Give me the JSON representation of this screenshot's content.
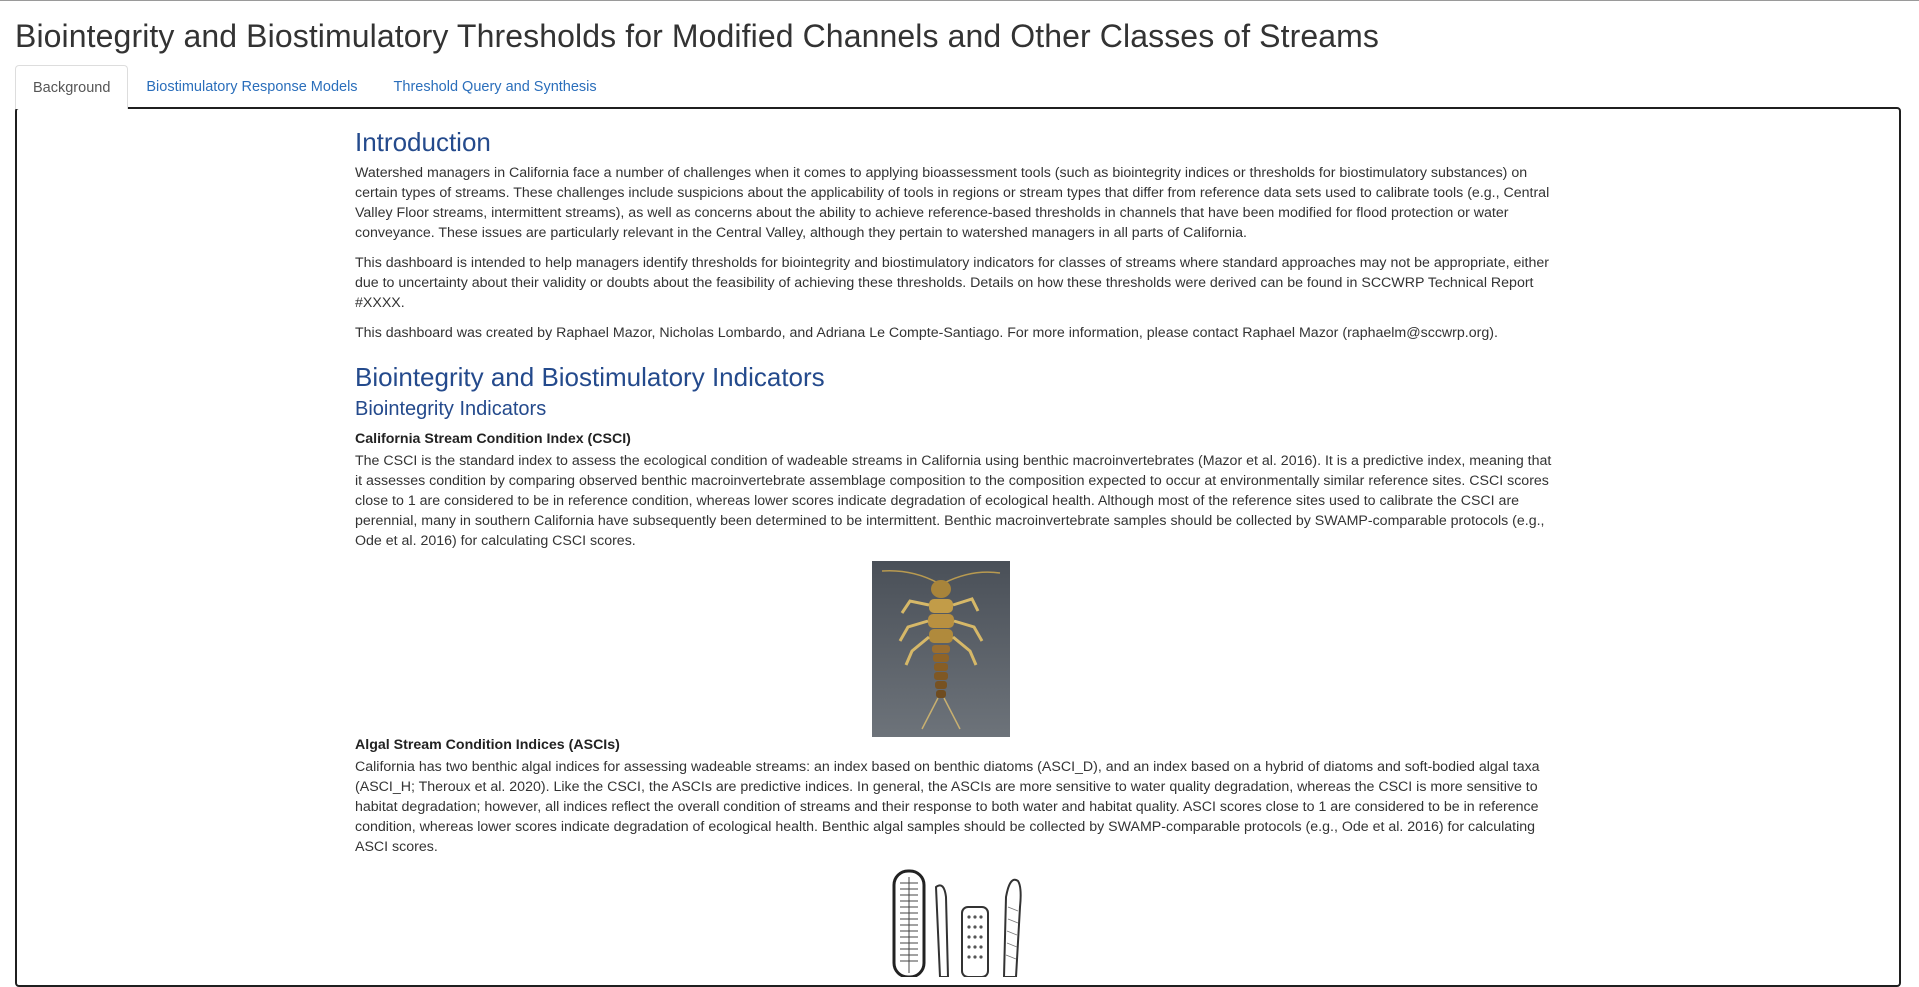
{
  "title": "Biointegrity and Biostimulatory Thresholds for Modified Channels and Other Classes of Streams",
  "tabs": [
    {
      "label": "Background",
      "active": true
    },
    {
      "label": "Biostimulatory Response Models",
      "active": false
    },
    {
      "label": "Threshold Query and Synthesis",
      "active": false
    }
  ],
  "intro": {
    "heading": "Introduction",
    "p1": "Watershed managers in California face a number of challenges when it comes to applying bioassessment tools (such as biointegrity indices or thresholds for biostimulatory substances) on certain types of streams. These challenges include suspicions about the applicability of tools in regions or stream types that differ from reference data sets used to calibrate tools (e.g., Central Valley Floor streams, intermittent streams), as well as concerns about the ability to achieve reference-based thresholds in channels that have been modified for flood protection or water conveyance. These issues are particularly relevant in the Central Valley, although they pertain to watershed managers in all parts of California.",
    "p2": "This dashboard is intended to help managers identify thresholds for biointegrity and biostimulatory indicators for classes of streams where standard approaches may not be appropriate, either due to uncertainty about their validity or doubts about the feasibility of achieving these thresholds. Details on how these thresholds were derived can be found in SCCWRP Technical Report #XXXX.",
    "p3": "This dashboard was created by Raphael Mazor, Nicholas Lombardo, and Adriana Le Compte-Santiago. For more information, please contact Raphael Mazor (raphaelm@sccwrp.org)."
  },
  "indicators": {
    "heading": "Biointegrity and Biostimulatory Indicators",
    "subheading": "Biointegrity Indicators",
    "csci_title": "California Stream Condition Index (CSCI)",
    "csci_text": "The CSCI is the standard index to assess the ecological condition of wadeable streams in California using benthic macroinvertebrates (Mazor et al. 2016). It is a predictive index, meaning that it assesses condition by comparing observed benthic macroinvertebrate assemblage composition to the composition expected to occur at environmentally similar reference sites. CSCI scores close to 1 are considered to be in reference condition, whereas lower scores indicate degradation of ecological health. Although most of the reference sites used to calibrate the CSCI are perennial, many in southern California have subsequently been determined to be intermittent. Benthic macroinvertebrate samples should be collected by SWAMP-comparable protocols (e.g., Ode et al. 2016) for calculating CSCI scores.",
    "asci_title": "Algal Stream Condition Indices (ASCIs)",
    "asci_text": "California has two benthic algal indices for assessing wadeable streams: an index based on benthic diatoms (ASCI_D), and an index based on a hybrid of diatoms and soft-bodied algal taxa (ASCI_H; Theroux et al. 2020). Like the CSCI, the ASCIs are predictive indices. In general, the ASCIs are more sensitive to water quality degradation, whereas the CSCI is more sensitive to habitat degradation; however, all indices reflect the overall condition of streams and their response to both water and habitat quality. ASCI scores close to 1 are considered to be in reference condition, whereas lower scores indicate degradation of ecological health. Benthic algal samples should be collected by SWAMP-comparable protocols (e.g., Ode et al. 2016) for calculating ASCI scores."
  },
  "colors": {
    "heading": "#244a8c",
    "link": "#2a6ebb",
    "text": "#333333"
  },
  "icons": {
    "macroinvertebrate": "stonefly-image",
    "algae": "diatom-drawing"
  }
}
